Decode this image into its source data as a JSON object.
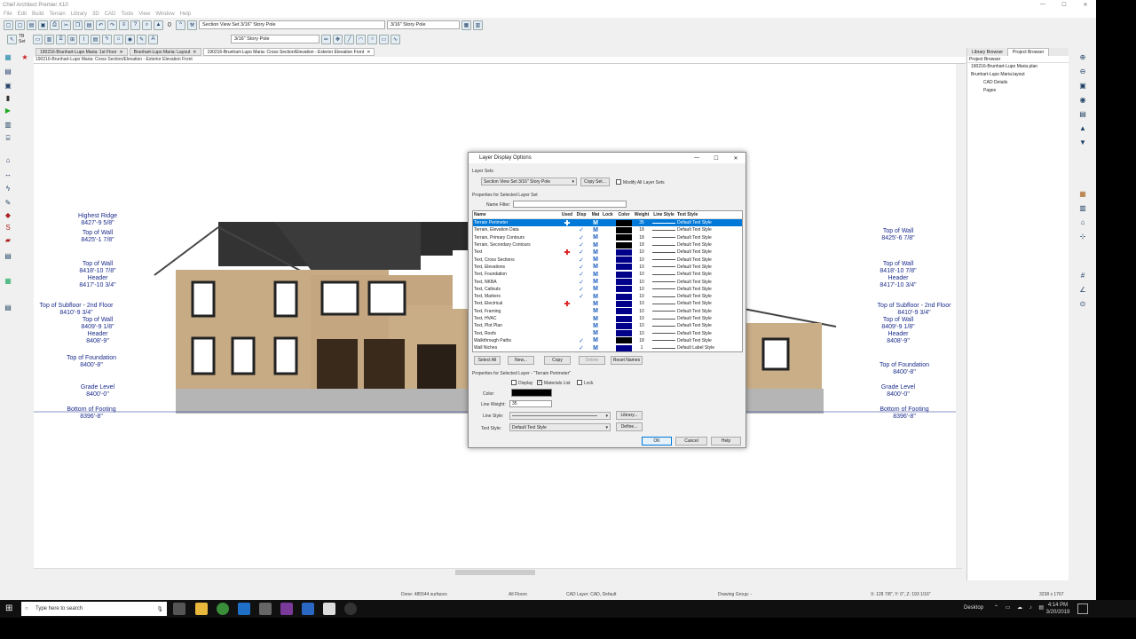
{
  "window": {
    "title": "Chief Architect Premier X10"
  },
  "menu": [
    "File",
    "Edit",
    "Build",
    "Terrain",
    "Library",
    "3D",
    "CAD",
    "Tools",
    "View",
    "Window",
    "Help"
  ],
  "toolbar": {
    "layer_set": "Section View Set 3/16\" Story Pole",
    "scale1": "3/16\" Story Pole",
    "scale2": "3/16\" Story Pole",
    "zero": "0",
    "tb_set": "TB Set"
  },
  "tabs": [
    {
      "label": "190216-Brunhart-Lupo Maria: 1st Floor"
    },
    {
      "label": "Brunhart-Lupo Maria: Layout"
    },
    {
      "label": "190216-Brunhart-Lupo Maria: Cross Section/Elevation - Exterior Elevation Front"
    }
  ],
  "view_title": "190216-Brunhart-Lupo Maria: Cross Section/Elevation - Exterior Elevation Front",
  "elevations_left": [
    {
      "label": "Highest Ridge",
      "dim": "8427'-9 5/8\""
    },
    {
      "label": "Top of Wall",
      "dim": "8425'-1 7/8\""
    },
    {
      "label": "Top of Wall",
      "dim": "8418'-10 7/8\""
    },
    {
      "label": "Header",
      "dim": "8417'-10 3/4\""
    },
    {
      "label": "Top of Subfloor - 2nd Floor",
      "dim": "8410'-9 3/4\""
    },
    {
      "label": "Top of Wall",
      "dim": "8409'-9 1/8\""
    },
    {
      "label": "Header",
      "dim": "8408'-9\""
    },
    {
      "label": "Top of Foundation",
      "dim": "8400'-8\""
    },
    {
      "label": "Grade Level",
      "dim": "8400'-0\""
    },
    {
      "label": "Bottom of Footing",
      "dim": "8396'-8\""
    }
  ],
  "elevations_right": [
    {
      "label": "Top of Wall",
      "dim": "8425'-6 7/8\""
    },
    {
      "label": "Top of Wall",
      "dim": "8418'-10 7/8\""
    },
    {
      "label": "Header",
      "dim": "8417'-10 3/4\""
    },
    {
      "label": "Top of Subfloor - 2nd Floor",
      "dim": "8410'-9 3/4\""
    },
    {
      "label": "Top of Wall",
      "dim": "8409'-9 1/8\""
    },
    {
      "label": "Header",
      "dim": "8408'-9\""
    },
    {
      "label": "Top of Foundation",
      "dim": "8400'-8\""
    },
    {
      "label": "Grade Level",
      "dim": "8400'-0\""
    },
    {
      "label": "Bottom of Footing",
      "dim": "8396'-8\""
    }
  ],
  "browser": {
    "tabs": [
      "Library Browser",
      "Project Browser"
    ],
    "header": "Project Browser",
    "items": [
      "190216-Brunhart-Lupo Maria.plan",
      "Brunhart-Lupo Maria.layout",
      "CAD Details",
      "Pages"
    ]
  },
  "dialog": {
    "title": "Layer Display Options",
    "layer_sets_label": "Layer Sets",
    "layer_set_value": "Section View Set 3/16\" Story Pole",
    "copy_set": "Copy Set...",
    "modify_all": "Modify All Layer Sets",
    "props_label": "Properties for Selected Layer Set",
    "name_filter": "Name Filter:",
    "columns": [
      "Name",
      "Used",
      "Disp",
      "Mat",
      "Lock",
      "Color",
      "Weight",
      "Line Style",
      "Text Style"
    ],
    "rows": [
      {
        "name": "Terrain Perimeter",
        "used": "✚",
        "disp": "",
        "mat": "M",
        "color": "#000000",
        "weight": "35",
        "ts": "Default Text Style"
      },
      {
        "name": "Terrain, Elevation Data",
        "used": "",
        "disp": "✓",
        "mat": "M",
        "color": "#000000",
        "weight": "18",
        "ts": "Default Text Style"
      },
      {
        "name": "Terrain, Primary Contours",
        "used": "",
        "disp": "✓",
        "mat": "M",
        "color": "#000000",
        "weight": "18",
        "ts": "Default Text Style"
      },
      {
        "name": "Terrain, Secondary Contours",
        "used": "",
        "disp": "✓",
        "mat": "M",
        "color": "#000000",
        "weight": "18",
        "ts": "Default Text Style"
      },
      {
        "name": "Text",
        "used": "✚",
        "disp": "✓",
        "mat": "M",
        "color": "#00008b",
        "weight": "10",
        "ts": "Default Text Style"
      },
      {
        "name": "Text, Cross Sections",
        "used": "",
        "disp": "✓",
        "mat": "M",
        "color": "#00008b",
        "weight": "10",
        "ts": "Default Text Style"
      },
      {
        "name": "Text, Elevations",
        "used": "",
        "disp": "✓",
        "mat": "M",
        "color": "#00008b",
        "weight": "10",
        "ts": "Default Text Style"
      },
      {
        "name": "Text, Foundation",
        "used": "",
        "disp": "✓",
        "mat": "M",
        "color": "#00008b",
        "weight": "10",
        "ts": "Default Text Style"
      },
      {
        "name": "Text, NKBA",
        "used": "",
        "disp": "✓",
        "mat": "M",
        "color": "#00008b",
        "weight": "10",
        "ts": "Default Text Style"
      },
      {
        "name": "Text, Callouts",
        "used": "",
        "disp": "✓",
        "mat": "M",
        "color": "#00008b",
        "weight": "10",
        "ts": "Default Text Style"
      },
      {
        "name": "Text, Markers",
        "used": "",
        "disp": "✓",
        "mat": "M",
        "color": "#00008b",
        "weight": "10",
        "ts": "Default Text Style"
      },
      {
        "name": "Text, Electrical",
        "used": "✚",
        "disp": "",
        "mat": "M",
        "color": "#00008b",
        "weight": "10",
        "ts": "Default Text Style"
      },
      {
        "name": "Text, Framing",
        "used": "",
        "disp": "",
        "mat": "M",
        "color": "#00008b",
        "weight": "10",
        "ts": "Default Text Style"
      },
      {
        "name": "Text, HVAC",
        "used": "",
        "disp": "",
        "mat": "M",
        "color": "#00008b",
        "weight": "10",
        "ts": "Default Text Style"
      },
      {
        "name": "Text, Plot Plan",
        "used": "",
        "disp": "",
        "mat": "M",
        "color": "#00008b",
        "weight": "10",
        "ts": "Default Text Style"
      },
      {
        "name": "Text, Roofs",
        "used": "",
        "disp": "",
        "mat": "M",
        "color": "#00008b",
        "weight": "10",
        "ts": "Default Text Style"
      },
      {
        "name": "Walkthrough Paths",
        "used": "",
        "disp": "✓",
        "mat": "M",
        "color": "#000000",
        "weight": "18",
        "ts": "Default Text Style"
      },
      {
        "name": "Wall Niches",
        "used": "",
        "disp": "✓",
        "mat": "M",
        "color": "#00008b",
        "weight": "1",
        "ts": "Default Label Style"
      }
    ],
    "buttons": [
      "Select All",
      "New...",
      "Copy",
      "Delete",
      "Reset Names"
    ],
    "selected_layer_label": "Properties for Selected Layer - \"Terrain Perimeter\"",
    "display": "Display",
    "materials_list": "Materials List",
    "lock": "Lock",
    "color_label": "Color:",
    "color_value": "#000000",
    "line_weight_label": "Line Weight:",
    "line_weight": "35",
    "line_style_label": "Line Style:",
    "library": "Library...",
    "text_style_label": "Text Style:",
    "text_style": "Default Text Style",
    "define": "Define...",
    "ok": "OK",
    "cancel": "Cancel",
    "help": "Help"
  },
  "status": {
    "done": "Done: 485544 surfaces",
    "floors": "All Floors",
    "cad_layer": "CAD Layer: CAD,  Default",
    "drawing_group": "Drawing Group: -",
    "coords": "X: 128 7/8\", Y: 0\", Z: 193 1/16\"",
    "size": "3238 x 1767"
  },
  "taskbar": {
    "search": "Type here to search",
    "desktop": "Desktop",
    "time": "4:14 PM",
    "date": "3/20/2019"
  }
}
